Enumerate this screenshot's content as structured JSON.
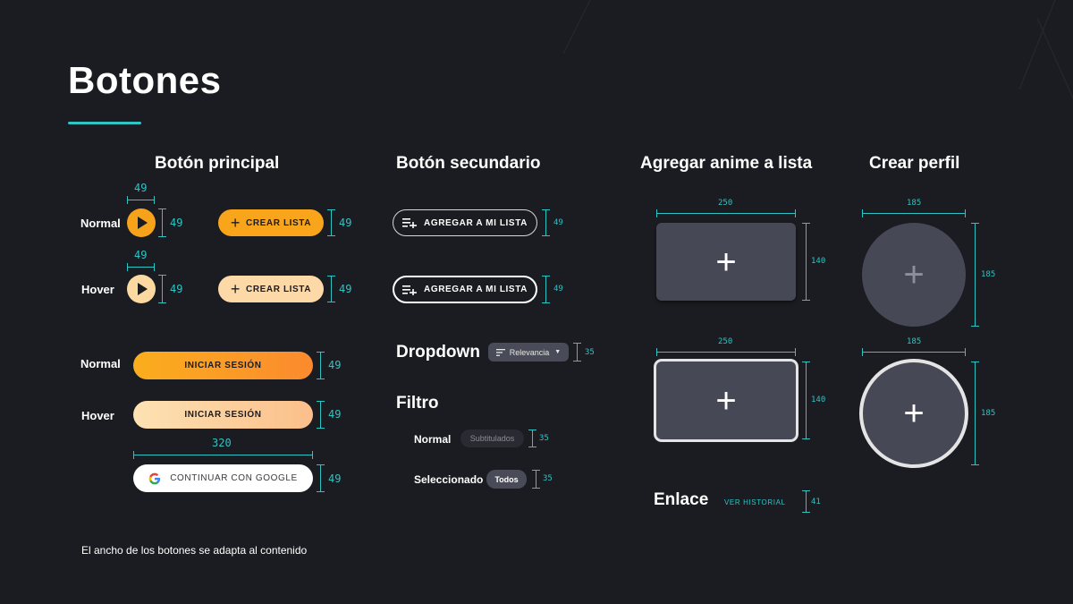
{
  "page": {
    "title": "Botones",
    "footnote": "El ancho de los botones se adapta al contenido"
  },
  "colors": {
    "background": "#1b1c21",
    "accent": "#2ec4c4",
    "primary_orange": "#f9a51c",
    "primary_hover": "#fcd9a6",
    "card": "#474856"
  },
  "primary": {
    "heading": "Botón principal",
    "state_normal": "Normal",
    "state_hover": "Hover",
    "play_icon": "play-icon",
    "play_width": "49",
    "play_height": "49",
    "crear_label": "CREAR LISTA",
    "crear_height": "49",
    "login_label": "INICIAR SESIÓN",
    "login_height": "49",
    "google_label": "CONTINUAR CON GOOGLE",
    "google_width": "320",
    "google_height": "49"
  },
  "secondary": {
    "heading": "Botón secundario",
    "agregar_label": "AGREGAR A MI LISTA",
    "agregar_height": "49",
    "list_icon": "playlist-add-icon"
  },
  "dropdown": {
    "heading": "Dropdown",
    "label": "Relevancia",
    "height": "35",
    "icon": "sort-icon"
  },
  "filtro": {
    "heading": "Filtro",
    "normal_state": "Normal",
    "normal_chip": "Subtitulados",
    "selected_state": "Seleccionado",
    "selected_chip": "Todos",
    "height": "35"
  },
  "agregar_anime": {
    "heading": "Agregar anime a lista",
    "width": "250",
    "height": "140"
  },
  "crear_perfil": {
    "heading": "Crear perfil",
    "width": "185",
    "height": "185"
  },
  "enlace": {
    "heading": "Enlace",
    "label": "VER HISTORIAL",
    "height": "41"
  }
}
